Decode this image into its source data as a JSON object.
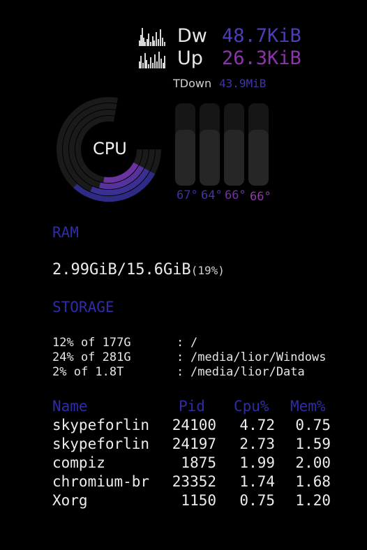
{
  "network": {
    "down": {
      "label": "Dw",
      "value": "48.7KiB"
    },
    "up": {
      "label": "Up",
      "value": "26.3KiB"
    },
    "total_down": {
      "label": "TDown",
      "value": "43.9MiB"
    }
  },
  "cpu": {
    "label": "CPU",
    "core_loads_pct": [
      22,
      18,
      16,
      15
    ]
  },
  "temps": [
    {
      "value": "67°",
      "color": "#3a32a2"
    },
    {
      "value": "64°",
      "color": "#4a32a6"
    },
    {
      "value": "66°",
      "color": "#6f34a6"
    },
    {
      "value": "66°",
      "color": "#8e3aa8"
    }
  ],
  "ram": {
    "title": "RAM",
    "value": "2.99GiB/15.6GiB",
    "percent": "(19%)"
  },
  "storage": {
    "title": "STORAGE",
    "rows": [
      {
        "usage": "12% of 177G",
        "sep": ":",
        "mount": "/"
      },
      {
        "usage": "24% of 281G",
        "sep": ":",
        "mount": "/media/lior/Windows"
      },
      {
        "usage": "2% of 1.8T",
        "sep": ":",
        "mount": "/media/lior/Data"
      }
    ]
  },
  "processes": {
    "headers": {
      "name": "Name",
      "pid": "Pid",
      "cpu": "Cpu%",
      "mem": "Mem%"
    },
    "rows": [
      {
        "name": "skypeforlin",
        "pid": "24100",
        "cpu": "4.72",
        "mem": "0.75"
      },
      {
        "name": "skypeforlin",
        "pid": "24197",
        "cpu": "2.73",
        "mem": "1.59"
      },
      {
        "name": "compiz",
        "pid": "1875",
        "cpu": "1.99",
        "mem": "2.00"
      },
      {
        "name": "chromium-br",
        "pid": "23352",
        "cpu": "1.74",
        "mem": "1.68"
      },
      {
        "name": "Xorg",
        "pid": "1150",
        "cpu": "0.75",
        "mem": "1.20"
      }
    ]
  },
  "colors": {
    "accent_blue": "#2f2ca8",
    "down_value": "#4a3fb4",
    "up_value": "#8a35a8",
    "track": "#1a1a1a"
  }
}
